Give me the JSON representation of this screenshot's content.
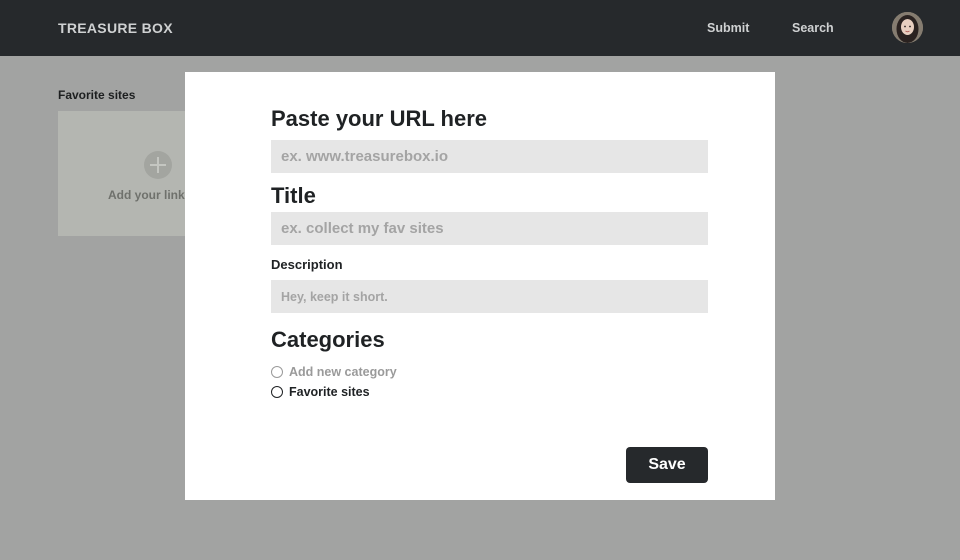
{
  "header": {
    "brand": "TREASURE BOX",
    "nav": {
      "submit": "Submit",
      "search": "Search"
    },
    "avatar_icon": "user-avatar"
  },
  "main": {
    "section_title": "Favorite sites",
    "add_card": {
      "label": "Add your link",
      "icon": "plus-circle-icon"
    }
  },
  "modal": {
    "url_heading": "Paste your URL here",
    "url_placeholder": "ex. www.treasurebox.io",
    "title_heading": "Title",
    "title_placeholder": "ex. collect my fav sites",
    "description_label": "Description",
    "description_placeholder": "Hey, keep it short.",
    "categories_heading": "Categories",
    "categories": [
      {
        "label": "Add new category",
        "selected": false
      },
      {
        "label": "Favorite sites",
        "selected": false
      }
    ],
    "save_label": "Save"
  },
  "colors": {
    "topbar": "#26292c",
    "overlay": "#a2a3a2",
    "modal_bg": "#ffffff",
    "field_bg": "#e6e6e6",
    "button": "#26292c"
  }
}
